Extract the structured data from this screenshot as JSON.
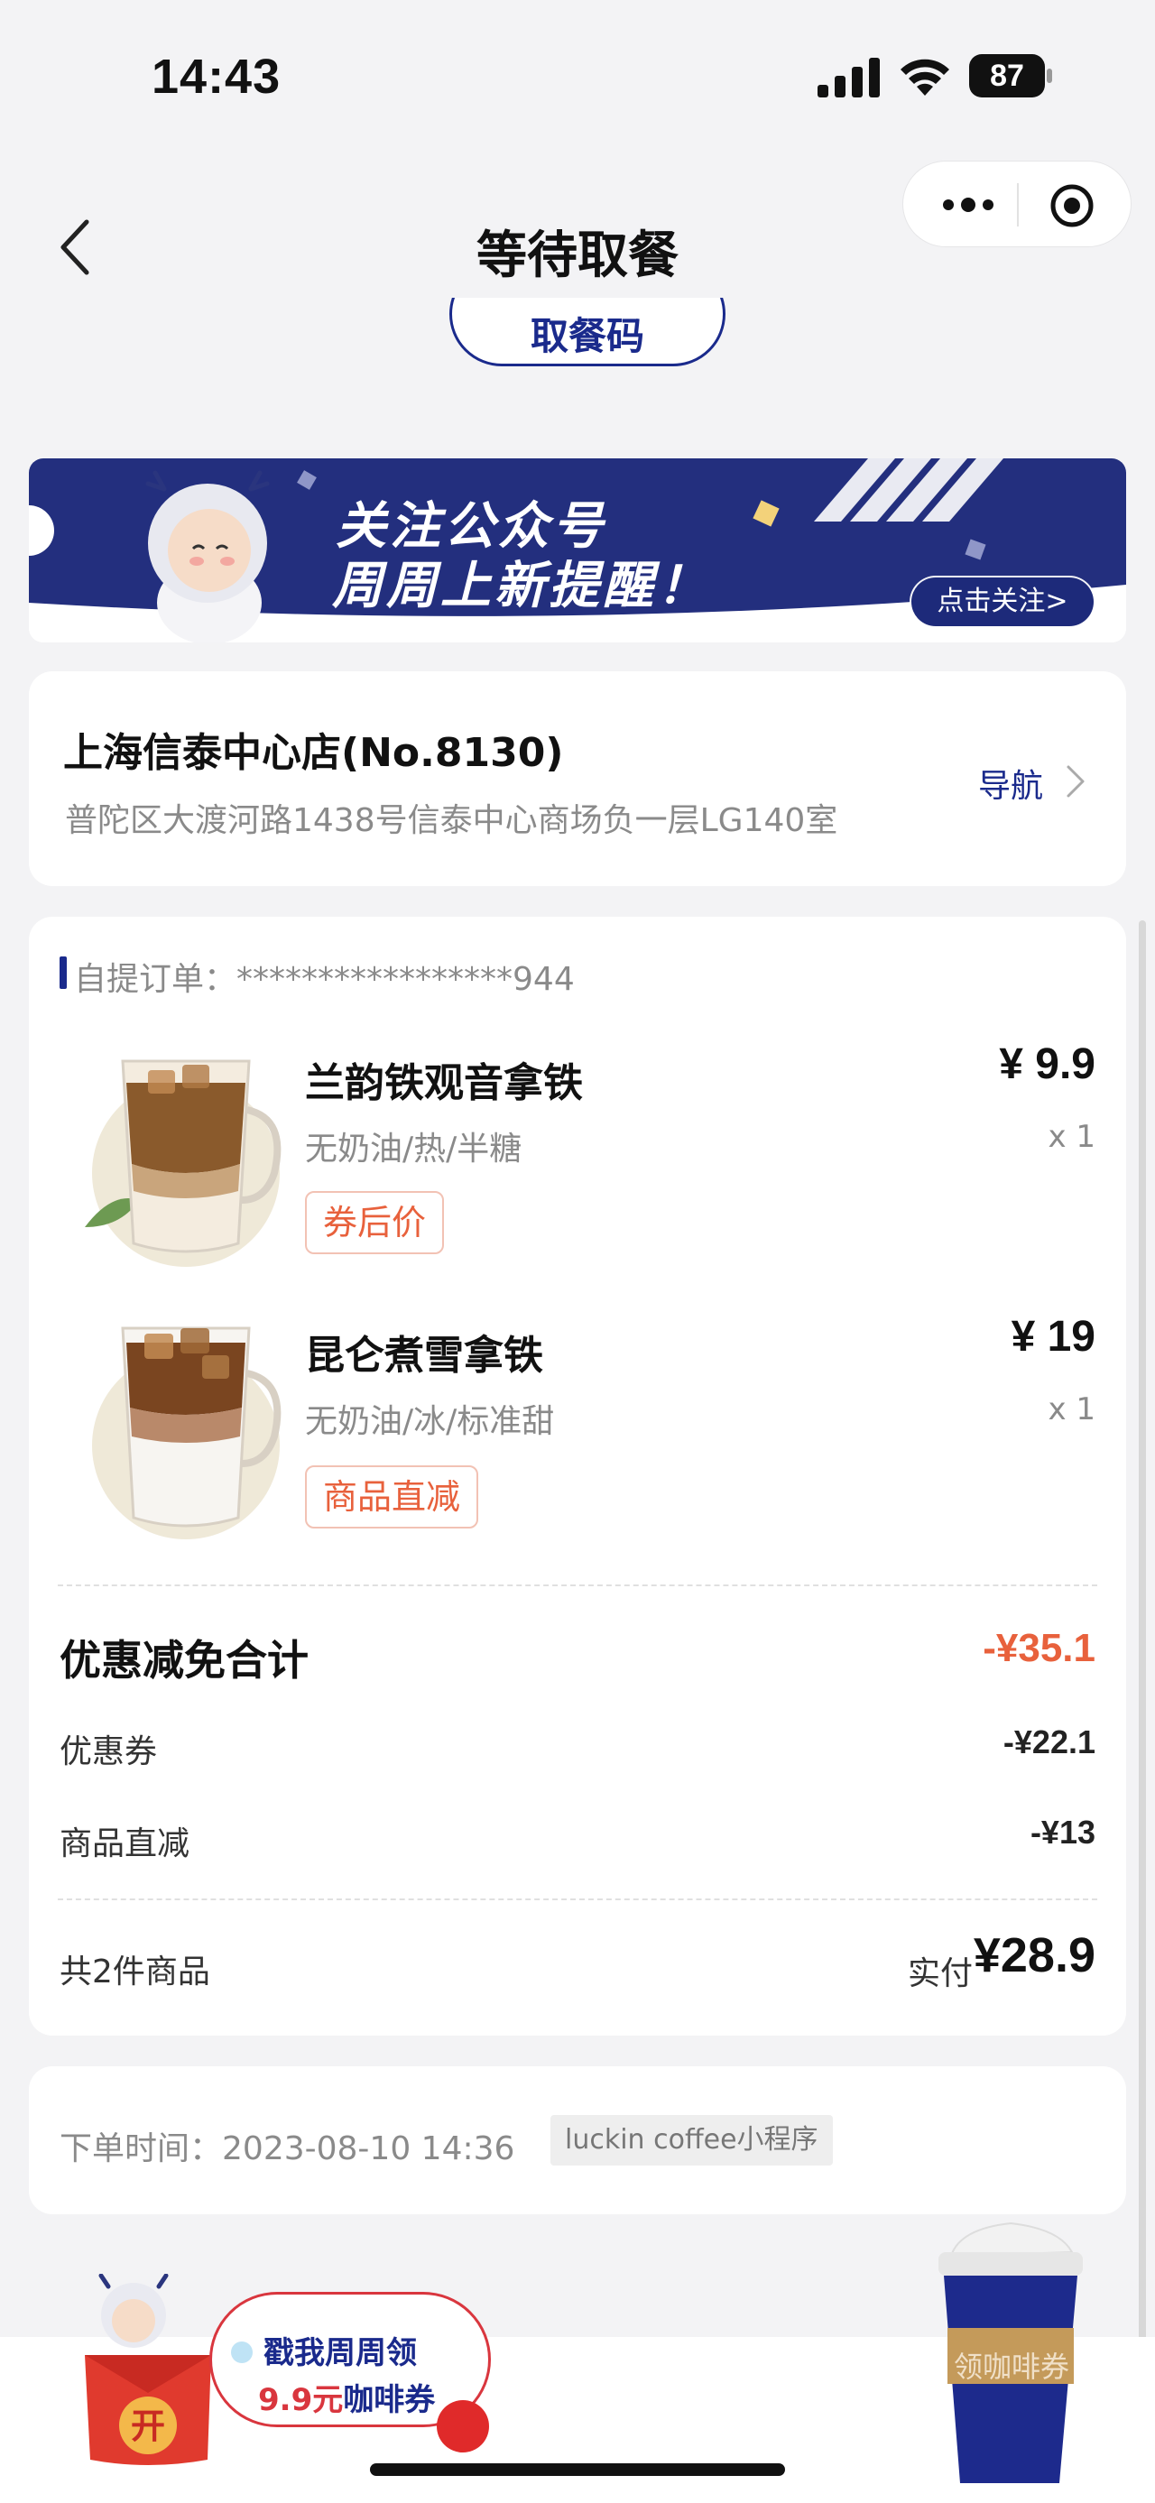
{
  "status_bar": {
    "time": "14:43",
    "battery": "87"
  },
  "nav": {
    "title": "等待取餐"
  },
  "pickup": {
    "button_label": "取餐码"
  },
  "banner": {
    "line1": "关注公众号",
    "line2": "周周上新提醒！",
    "button": "点击关注>"
  },
  "store": {
    "name": "上海信泰中心店(No.8130)",
    "address": "普陀区大渡河路1438号信泰中心商场负一层LG140室",
    "nav_label": "导航"
  },
  "order": {
    "label": "自提订单：",
    "number": "*****************944",
    "items": [
      {
        "name": "兰韵铁观音拿铁",
        "spec": "无奶油/热/半糖",
        "tag": "券后价",
        "price": "¥ 9.9",
        "qty": "x 1"
      },
      {
        "name": "昆仑煮雪拿铁",
        "spec": "无奶油/冰/标准甜",
        "tag": "商品直减",
        "price": "¥ 19",
        "qty": "x 1"
      }
    ],
    "discount_total_label": "优惠减免合计",
    "discount_total_value": "-¥35.1",
    "discounts": [
      {
        "label": "优惠券",
        "value": "-¥22.1"
      },
      {
        "label": "商品直减",
        "value": "-¥13"
      }
    ],
    "count_label": "共2件商品",
    "paid_label": "实付",
    "paid_value": "¥28.9"
  },
  "meta": {
    "time_label": "下单时间：",
    "time_value": "2023-08-10 14:36",
    "source": "luckin coffee小程序"
  },
  "promo": {
    "line1": "戳我周周领",
    "line2_amount": "9.9元",
    "line2_rest": "咖啡券",
    "envelope_char": "开",
    "coupon_label": "领咖啡券"
  },
  "colors": {
    "brand_blue": "#1a2a8c",
    "accent_orange": "#e8613c",
    "red": "#d9363e"
  }
}
